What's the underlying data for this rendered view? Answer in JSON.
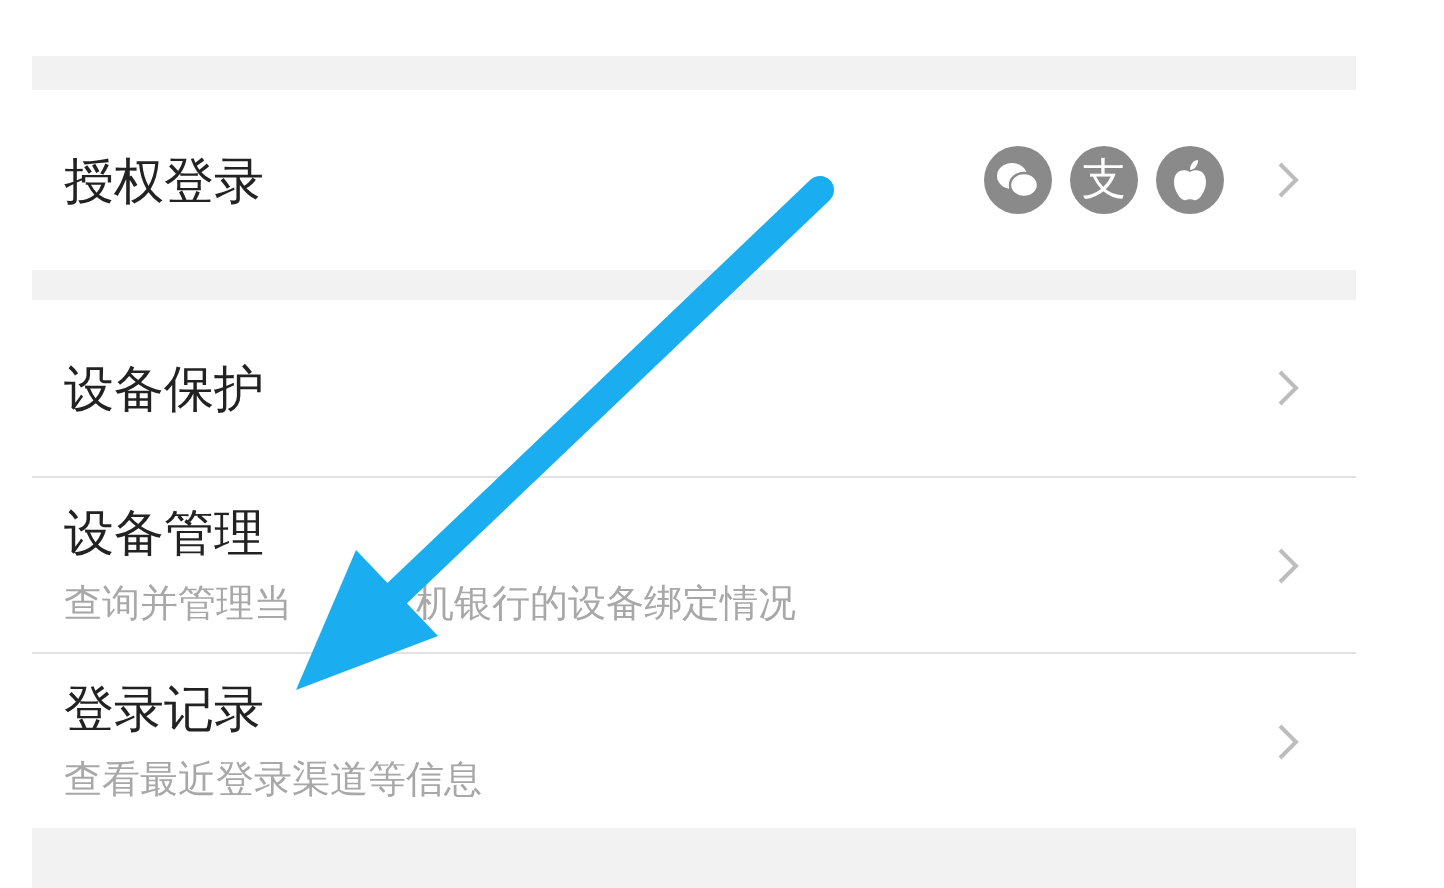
{
  "sections": [
    {
      "rows": [
        {
          "title": "授权登录",
          "badges": [
            {
              "kind": "chat"
            },
            {
              "kind": "text",
              "text": "支"
            },
            {
              "kind": "apple"
            }
          ]
        }
      ]
    },
    {
      "rows": [
        {
          "title": "设备保护"
        },
        {
          "title": "设备管理",
          "subtitle_parts": [
            "查询并管理当",
            "机银行的设备绑定情况"
          ]
        },
        {
          "title": "登录记录",
          "subtitle_parts": [
            "查看最近登录渠道等信息"
          ]
        }
      ]
    }
  ]
}
